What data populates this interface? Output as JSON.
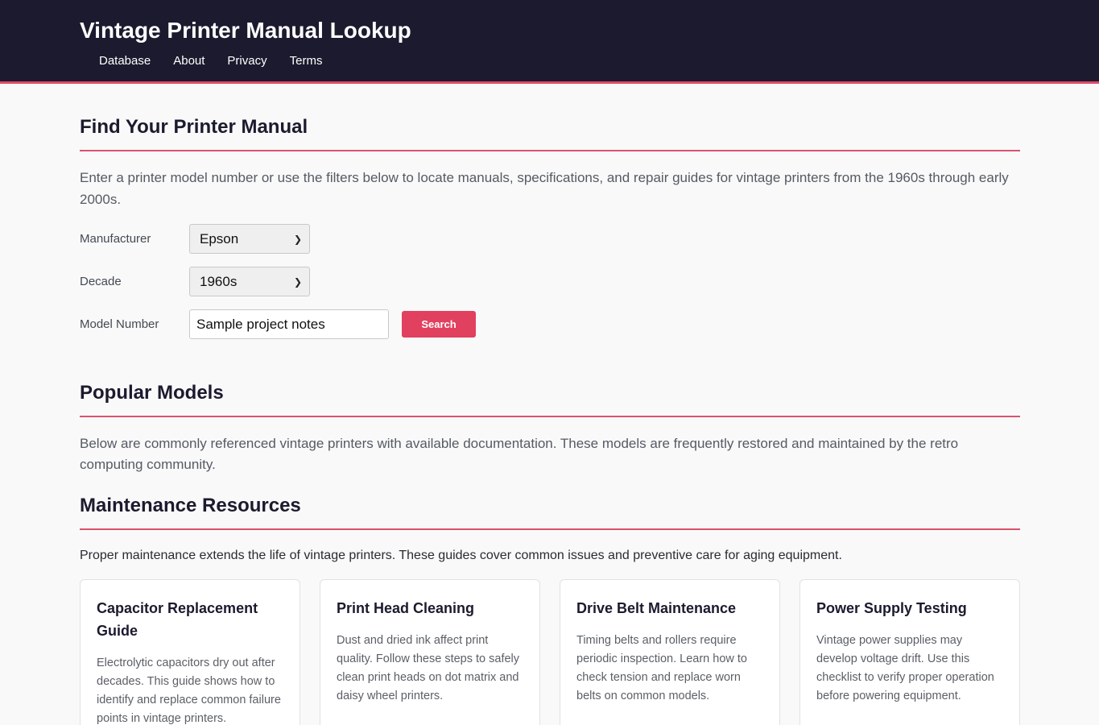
{
  "header": {
    "title": "Vintage Printer Manual Lookup",
    "nav": [
      "Database",
      "About",
      "Privacy",
      "Terms"
    ]
  },
  "find": {
    "title": "Find Your Printer Manual",
    "intro": "Enter a printer model number or use the filters below to locate manuals, specifications, and repair guides for vintage printers from the 1960s through early 2000s.",
    "manufacturer_label": "Manufacturer",
    "manufacturer_value": "Epson",
    "decade_label": "Decade",
    "decade_value": "1960s",
    "model_label": "Model Number",
    "model_value": "Sample project notes",
    "search_label": "Search"
  },
  "popular": {
    "title": "Popular Models",
    "text": "Below are commonly referenced vintage printers with available documentation. These models are frequently restored and maintained by the retro computing community."
  },
  "maintenance": {
    "title": "Maintenance Resources",
    "text": "Proper maintenance extends the life of vintage printers. These guides cover common issues and preventive care for aging equipment.",
    "cards": [
      {
        "title": "Capacitor Replacement Guide",
        "text": "Electrolytic capacitors dry out after decades. This guide shows how to identify and replace common failure points in vintage printers."
      },
      {
        "title": "Print Head Cleaning",
        "text": "Dust and dried ink affect print quality. Follow these steps to safely clean print heads on dot matrix and daisy wheel printers."
      },
      {
        "title": "Drive Belt Maintenance",
        "text": "Timing belts and rollers require periodic inspection. Learn how to check tension and replace worn belts on common models."
      },
      {
        "title": "Power Supply Testing",
        "text": "Vintage power supplies may develop voltage drift. Use this checklist to verify proper operation before powering equipment."
      }
    ]
  },
  "colors": {
    "header_bg": "#1b1a2e",
    "accent": "#e1405f"
  }
}
